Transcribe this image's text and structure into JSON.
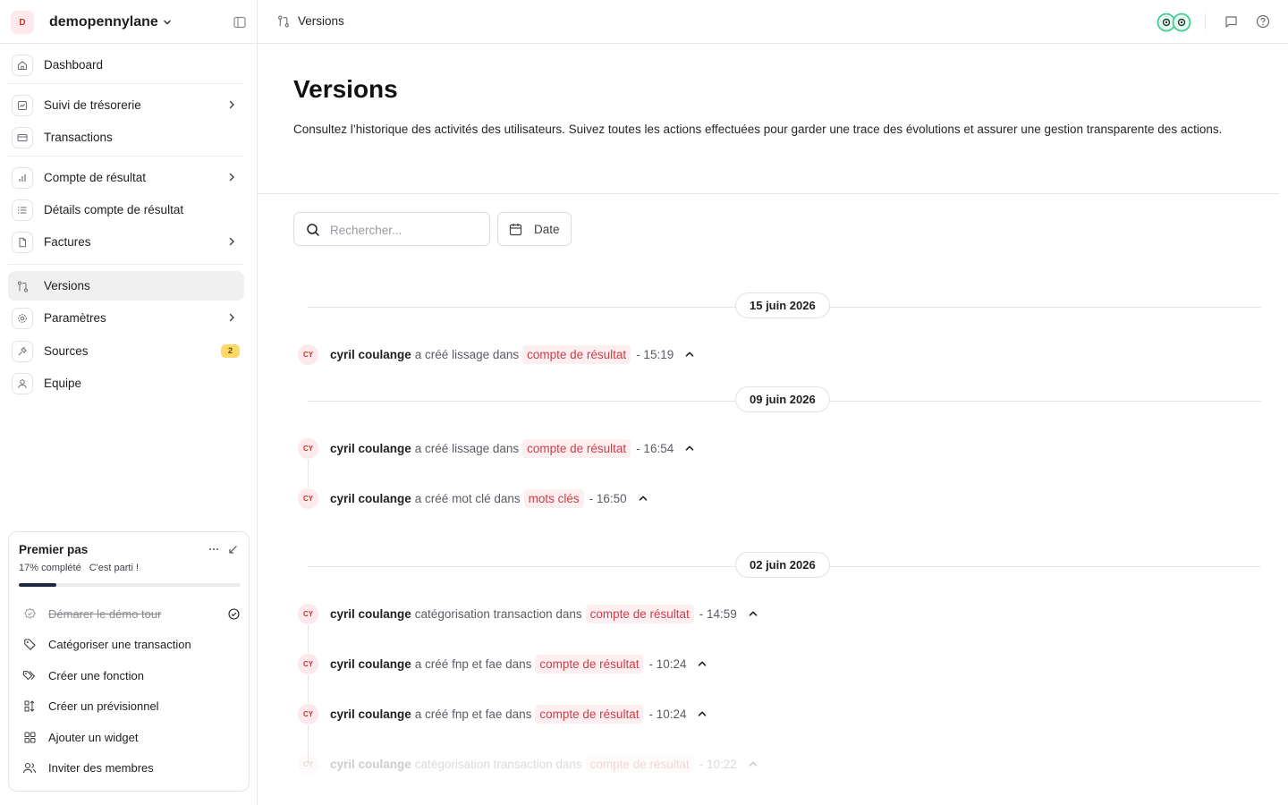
{
  "sidebar": {
    "org_initial": "D",
    "org_name": "demopennylane",
    "items": [
      {
        "label": "Dashboard"
      },
      {
        "label": "Suivi de trésorerie"
      },
      {
        "label": "Transactions"
      },
      {
        "label": "Compte de résultat"
      },
      {
        "label": "Détails compte de résultat"
      },
      {
        "label": "Factures"
      },
      {
        "label": "Versions"
      },
      {
        "label": "Paramètres"
      },
      {
        "label": "Sources",
        "badge": "2"
      },
      {
        "label": "Equipe"
      }
    ],
    "onboarding": {
      "title": "Premier pas",
      "progress_text": "17% complété",
      "progress_msg": "C'est parti !",
      "progress_value": 0.17,
      "steps": [
        {
          "label": "Démarer le démo tour"
        },
        {
          "label": "Catégoriser une transaction"
        },
        {
          "label": "Créer une fonction"
        },
        {
          "label": "Créer un prévisionnel"
        },
        {
          "label": "Ajouter un widget"
        },
        {
          "label": "Inviter des membres"
        }
      ]
    }
  },
  "topbar": {
    "breadcrumb": "Versions"
  },
  "main": {
    "title": "Versions",
    "description": "Consultez l’historique des activités des utilisateurs. Suivez toutes les actions effectuées pour garder une trace des évolutions et assurer une gestion transparente des actions.",
    "search_placeholder": "Rechercher...",
    "date_label": "Date"
  },
  "timeline": [
    {
      "date": "15 juin 2026",
      "events": [
        {
          "initials": "CY",
          "user": "cyril coulange",
          "action": "a créé lissage dans",
          "target": "compte de résultat",
          "time": "- 15:19"
        }
      ]
    },
    {
      "date": "09 juin 2026",
      "events": [
        {
          "initials": "CY",
          "user": "cyril coulange",
          "action": "a créé lissage dans",
          "target": "compte de résultat",
          "time": "- 16:54"
        },
        {
          "initials": "CY",
          "user": "cyril coulange",
          "action": "a créé mot clé dans",
          "target": "mots clés",
          "time": "- 16:50"
        }
      ]
    },
    {
      "date": "02 juin 2026",
      "events": [
        {
          "initials": "CY",
          "user": "cyril coulange",
          "action": "catégorisation transaction dans",
          "target": "compte de résultat",
          "time": "- 14:59"
        },
        {
          "initials": "CY",
          "user": "cyril coulange",
          "action": "a créé fnp et fae dans",
          "target": "compte de résultat",
          "time": "- 10:24"
        },
        {
          "initials": "CY",
          "user": "cyril coulange",
          "action": "a créé fnp et fae dans",
          "target": "compte de résultat",
          "time": "- 10:24"
        },
        {
          "initials": "CY",
          "user": "cyril coulange",
          "action": "catégorisation transaction dans",
          "target": "compte de résultat",
          "time": "- 10:22"
        }
      ]
    }
  ],
  "colors": {
    "accent_tag_bg": "#fdeef0",
    "accent_tag_text": "#c8414c",
    "badge": "#ffd866",
    "progress": "#1f2640",
    "brand_logo": "#3ecf8e"
  }
}
